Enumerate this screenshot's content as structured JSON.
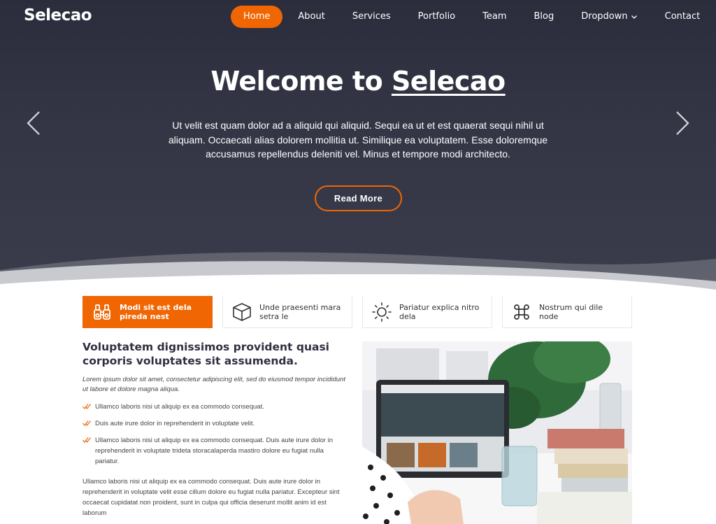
{
  "header": {
    "logo": "Selecao",
    "nav": [
      {
        "label": "Home",
        "active": true
      },
      {
        "label": "About"
      },
      {
        "label": "Services"
      },
      {
        "label": "Portfolio"
      },
      {
        "label": "Team"
      },
      {
        "label": "Blog"
      },
      {
        "label": "Dropdown",
        "has_caret": true
      },
      {
        "label": "Contact"
      }
    ]
  },
  "hero": {
    "title_prefix": "Welcome to",
    "title_brand": "Selecao",
    "text": "Ut velit est quam dolor ad a aliquid qui aliquid. Sequi ea ut et est quaerat sequi nihil ut aliquam. Occaecati alias dolorem mollitia ut. Similique ea voluptatem. Esse doloremque accusamus repellendus deleniti vel. Minus et tempore modi architecto.",
    "button": "Read More"
  },
  "features": [
    {
      "icon": "binoculars-icon",
      "label": "Modi sit est dela pireda nest",
      "active": true
    },
    {
      "icon": "box-icon",
      "label": "Unde praesenti mara setra le"
    },
    {
      "icon": "sun-icon",
      "label": "Pariatur explica nitro dela"
    },
    {
      "icon": "command-icon",
      "label": "Nostrum qui dile node"
    }
  ],
  "content": {
    "title": "Voluptatem dignissimos provident quasi corporis voluptates sit assumenda.",
    "lead": "Lorem ipsum dolor sit amet, consectetur adipiscing elit, sed do eiusmod tempor incididunt ut labore et dolore magna aliqua.",
    "list": [
      "Ullamco laboris nisi ut aliquip ex ea commodo consequat.",
      "Duis aute irure dolor in reprehenderit in voluptate velit.",
      "Ullamco laboris nisi ut aliquip ex ea commodo consequat. Duis aute irure dolor in reprehenderit in voluptate trideta storacalaperda mastiro dolore eu fugiat nulla pariatur."
    ],
    "paragraph": "Ullamco laboris nisi ut aliquip ex ea commodo consequat. Duis aute irure dolor in reprehenderit in voluptate velit esse cillum dolore eu fugiat nulla pariatur. Excepteur sint occaecat cupidatat non proident, sunt in culpa qui officia deserunt mollit anim id est laborum",
    "image_alt_icon": "laptop-photo"
  },
  "colors": {
    "accent": "#ef6603",
    "hero_dark": "#2b2d3c",
    "heading": "#2f2f42"
  }
}
